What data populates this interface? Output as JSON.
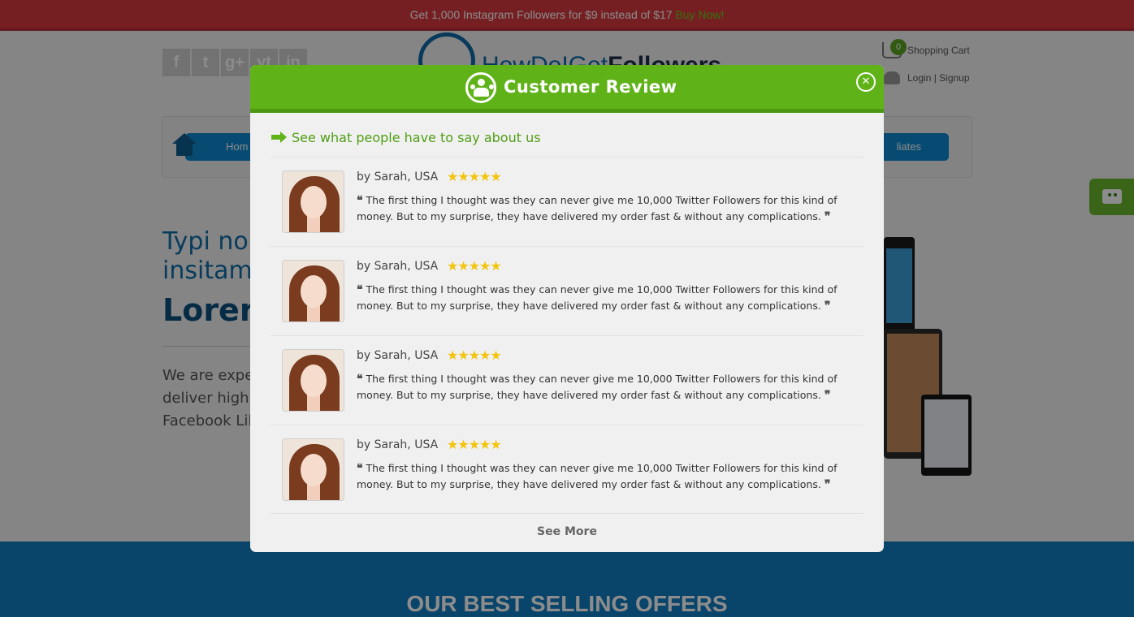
{
  "promo": {
    "text": "Get 1,000 Instagram Followers for $9 instead of $17",
    "link": "Buy Now!"
  },
  "social_icons": [
    "f",
    "t",
    "g+",
    "yt",
    "in"
  ],
  "logo": {
    "part1": "HowDoIGet",
    "part2": "Followers"
  },
  "header": {
    "cart_count": "0",
    "cart_label": "Shopping Cart",
    "login_label": "Login | Signup"
  },
  "nav": {
    "home_label": "Hom",
    "last_label": "liates"
  },
  "hero": {
    "line1": "Typi no",
    "line2": "insitam",
    "heading": "Lorer",
    "para1": "We are expe",
    "para2": "deliver high",
    "para3": "Facebook Lil"
  },
  "offers": {
    "title": "OUR BEST SELLING OFFERS"
  },
  "modal": {
    "title": "Customer Review",
    "close_symbol": "✕",
    "subhead": "See what people have to say about us",
    "see_more": "See More",
    "reviews": [
      {
        "reviewer": "by Sarah, USA",
        "rating": 5,
        "stars": "★★★★★",
        "open_quote": "❝",
        "text": "The first thing I thought was they can never give me 10,000 Twitter Followers for this kind of money. But to my surprise, they have delivered my order fast & without any complications.",
        "close_quote": "❞"
      },
      {
        "reviewer": "by Sarah, USA",
        "rating": 5,
        "stars": "★★★★★",
        "open_quote": "❝",
        "text": "The first thing I thought was they can never give me 10,000 Twitter Followers for this kind of money. But to my surprise, they have delivered my order fast & without any complications.",
        "close_quote": "❞"
      },
      {
        "reviewer": "by Sarah, USA",
        "rating": 5,
        "stars": "★★★★★",
        "open_quote": "❝",
        "text": "The first thing I thought was they can never give me 10,000 Twitter Followers for this kind of money. But to my surprise, they have delivered my order fast & without any complications.",
        "close_quote": "❞"
      },
      {
        "reviewer": "by Sarah, USA",
        "rating": 5,
        "stars": "★★★★★",
        "open_quote": "❝",
        "text": "The first thing I thought was they can never give me 10,000 Twitter Followers for this kind of money. But to my surprise, they have delivered my order fast & without any complications.",
        "close_quote": "❞"
      }
    ]
  },
  "colors": {
    "modal_green": "#5fb319",
    "promo_red": "#d63a3f",
    "brand_blue": "#0f6aa8",
    "star_yellow": "#f3c40b"
  }
}
